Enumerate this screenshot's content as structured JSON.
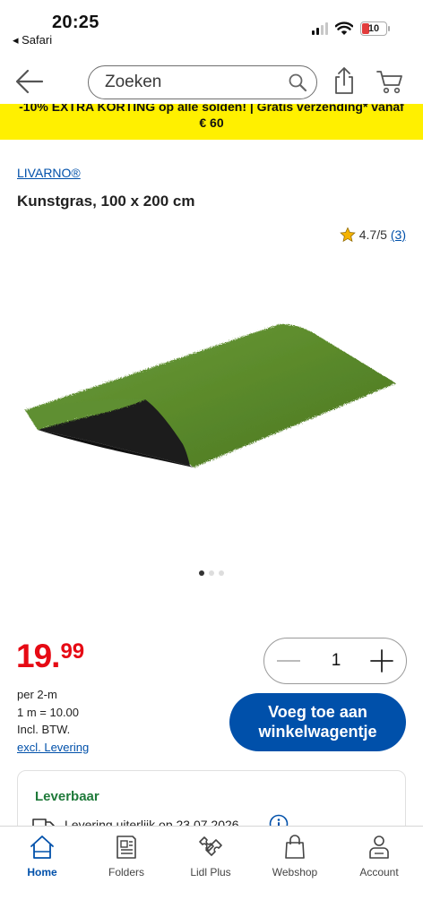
{
  "status": {
    "time": "20:25",
    "back_app": "◂ Safari",
    "battery": "10"
  },
  "header": {
    "search_placeholder": "Zoeken"
  },
  "promo": {
    "line1": "-10% EXTRA KORTING op alle solden! | Gratis verzending* vanaf",
    "line2": "€ 60"
  },
  "product": {
    "brand": "LIVARNO®",
    "title": "Kunstgras, 100 x 200 cm",
    "rating": "4.7/5",
    "rating_count": "(3)",
    "image_name": "artificial-grass-mat",
    "gallery_dots": 3,
    "gallery_active": 1
  },
  "price": {
    "main": "19.",
    "decimals": "99",
    "unit": "per 2-m",
    "per_meter": "1 m = 10.00",
    "vat": "Incl. BTW.",
    "delivery_link": "excl. Levering"
  },
  "quantity": {
    "value": "1"
  },
  "cart_button": {
    "line1": "Voeg toe aan",
    "line2": "winkelwagentje"
  },
  "availability": {
    "title": "Leverbaar",
    "delivery_text": "Levering uiterlijk op 23.07.2026"
  },
  "tabs": [
    {
      "label": "Home",
      "icon": "home-icon",
      "active": true
    },
    {
      "label": "Folders",
      "icon": "folders-icon",
      "active": false
    },
    {
      "label": "Lidl Plus",
      "icon": "ticket-icon",
      "active": false
    },
    {
      "label": "Webshop",
      "icon": "bag-icon",
      "active": false
    },
    {
      "label": "Account",
      "icon": "account-icon",
      "active": false
    }
  ],
  "colors": {
    "accent_blue": "#0050aa",
    "price_red": "#e60a14",
    "promo_yellow": "#fff000",
    "available_green": "#1f7a3a"
  }
}
